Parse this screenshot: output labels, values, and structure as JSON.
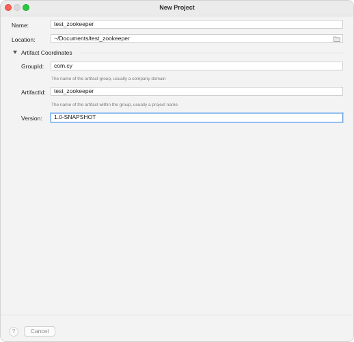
{
  "window": {
    "title": "New Project"
  },
  "form": {
    "name": {
      "label": "Name:",
      "value": "test_zookeeper"
    },
    "location": {
      "label": "Location:",
      "value": "~/Documents/test_zookeeper"
    }
  },
  "artifact": {
    "section_label": "Artifact Coordinates",
    "group_id": {
      "label": "GroupId:",
      "value": "com.cy",
      "hint": "The name of the artifact group, usually a company domain"
    },
    "artifact_id": {
      "label": "ArtifactId:",
      "value": "test_zookeeper",
      "hint": "The name of the artifact within the group, usually a project name"
    },
    "version": {
      "label": "Version:",
      "value": "1.0-SNAPSHOT"
    }
  },
  "footer": {
    "help_label": "?",
    "cancel_label": "Cancel"
  },
  "icons": {
    "folder": "folder-icon",
    "disclosure": "triangle-down-icon"
  },
  "colors": {
    "focus_accent": "#5b9be6",
    "close": "#ff5f57",
    "maximize": "#28c840"
  }
}
